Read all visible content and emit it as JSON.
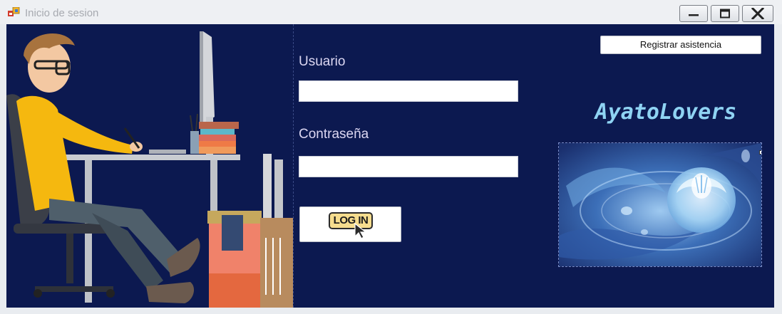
{
  "window": {
    "title": "Inicio de sesion",
    "buttons": [
      "minimize",
      "maximize",
      "close"
    ]
  },
  "form": {
    "usuario_label": "Usuario",
    "usuario_value": "",
    "contrasena_label": "Contraseña",
    "contrasena_value": "",
    "login_label": "LOG IN"
  },
  "header": {
    "register_label": "Registrar asistencia"
  },
  "brand": {
    "name": "AyatoLovers"
  },
  "colors": {
    "background": "#0c1950",
    "label": "#dcd7f2",
    "brand": "#8fd3f3",
    "shirt": "#f5b80f"
  },
  "icons": {
    "app": "windows-forms-app-icon",
    "login_cursor": "pointer-cursor-icon"
  }
}
